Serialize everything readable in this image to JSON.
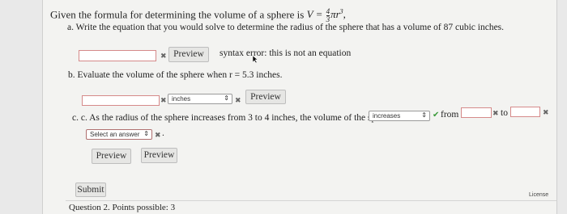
{
  "question": {
    "prompt": "Given the formula for determining the volume of a sphere is",
    "formula_lhs": "V =",
    "formula_num": "4",
    "formula_den": "3",
    "formula_rest": "πr",
    "formula_exp": "3",
    "formula_end": ","
  },
  "part_a": {
    "label": "a. Write the equation that you would solve to determine the radius of the sphere that has a volume of 87 cubic inches.",
    "answer_value": "",
    "preview_label": "Preview",
    "error_text": "syntax error: this is not an equation"
  },
  "part_b": {
    "label": "b. Evaluate the volume of the sphere when r = 5.3 inches.",
    "answer_value": "",
    "units_selected": "inches",
    "preview_label": "Preview"
  },
  "part_c": {
    "label": "c. c. As the radius of the sphere increases from 3 to 4 inches, the volume of the sphere",
    "trend_selected": "increases",
    "from_label": "from",
    "to_label": "to",
    "from_value": "",
    "to_value": "",
    "select_placeholder": "Select an answer",
    "period": ".",
    "preview1_label": "Preview",
    "preview2_label": "Preview"
  },
  "footer": {
    "submit_label": "Submit",
    "next_question": "Question 2. Points possible: 3",
    "license_label": "License"
  },
  "colors": {
    "card_bg": "#f3f3f1",
    "error_border": "#d58a8a",
    "check_green": "#3a9a3a"
  }
}
